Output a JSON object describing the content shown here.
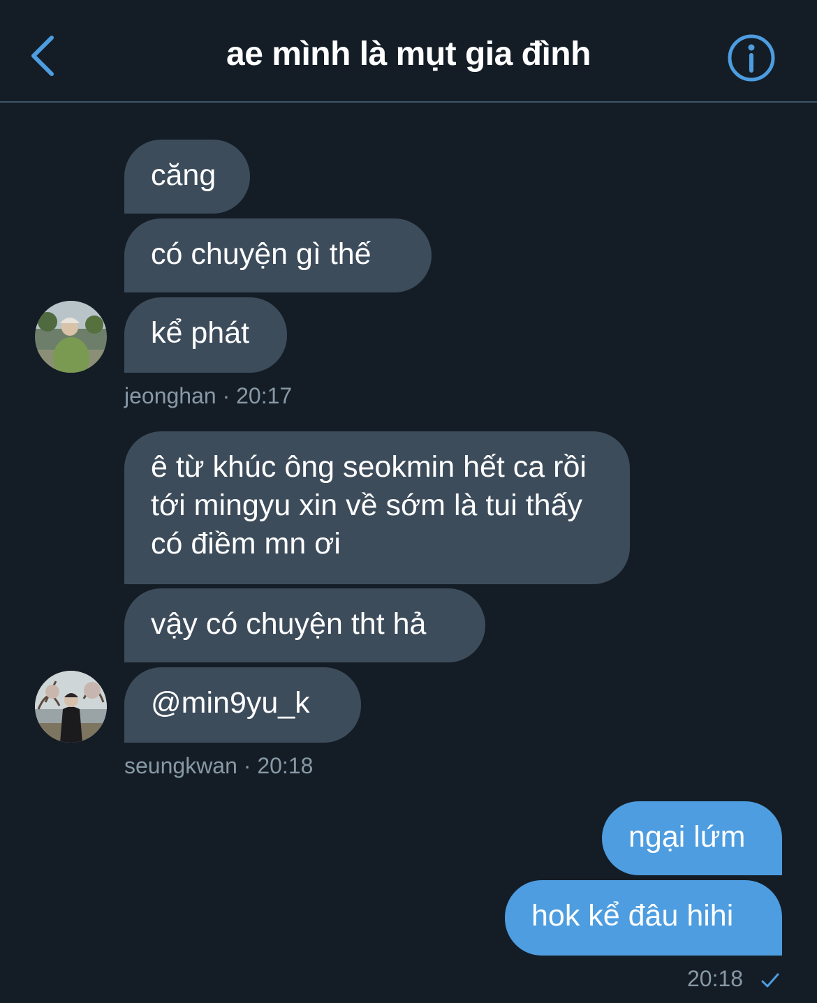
{
  "header": {
    "title": "ae mình là mụt gia đình",
    "back_icon": "chevron-left-icon",
    "info_icon": "info-icon",
    "accent_color": "#4d9de0"
  },
  "groups": [
    {
      "sender": "jeonghan",
      "time": "20:17",
      "meta": "jeonghan · 20:17",
      "messages": [
        "căng",
        "có chuyện gì thế",
        "kể phát"
      ]
    },
    {
      "sender": "seungkwan",
      "time": "20:18",
      "meta": "seungkwan · 20:18",
      "messages": [
        "ê từ khúc ông seokmin hết ca rồi tới mingyu xin về sớm là tui thấy có điềm mn ơi",
        "vậy có chuyện tht hả",
        "@min9yu_k"
      ]
    }
  ],
  "outgoing": {
    "messages": [
      "ngại lứm",
      "hok kể đâu hihi"
    ],
    "time": "20:18",
    "status_icon": "check-icon"
  },
  "colors": {
    "background": "#141d26",
    "incoming_bubble": "#3d4c5b",
    "outgoing_bubble": "#4d9de0",
    "meta_text": "#8899a6"
  }
}
